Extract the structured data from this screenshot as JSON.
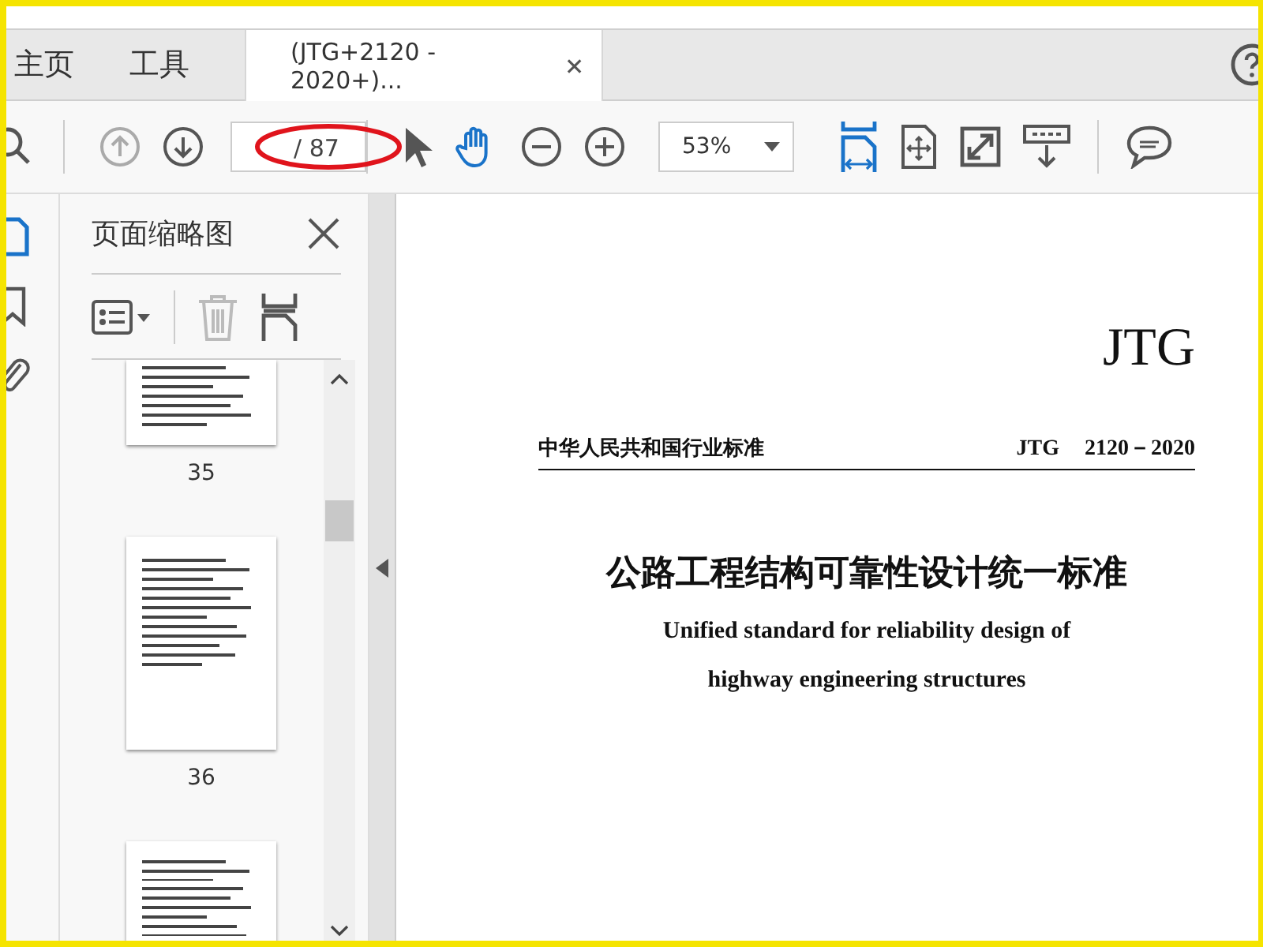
{
  "tabs": [
    {
      "label": "主页",
      "selected": false
    },
    {
      "label": "工具",
      "selected": false
    },
    {
      "label": "(JTG+2120 - 2020+)...",
      "selected": true
    }
  ],
  "toolbar": {
    "page_total": "/ 87",
    "zoom": "53%"
  },
  "panel": {
    "title": "页面缩略图",
    "thumbnails": [
      {
        "page": "35"
      },
      {
        "page": "36"
      }
    ]
  },
  "document": {
    "logo": "JTG",
    "header_left": "中华人民共和国行业标准",
    "header_code": "JTG",
    "header_number": "2120－2020",
    "title": "公路工程结构可靠性设计统一标准",
    "subtitle_lines": [
      "Unified standard for reliability design of",
      "highway engineering structures"
    ]
  }
}
